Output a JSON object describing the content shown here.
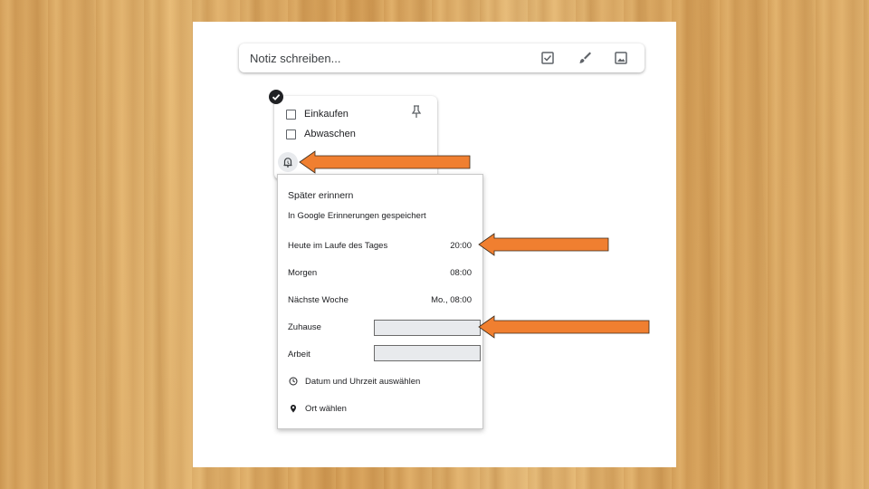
{
  "note_bar": {
    "placeholder": "Notiz schreiben...",
    "icons": [
      "checkbox-icon",
      "brush-icon",
      "image-icon"
    ]
  },
  "note_card": {
    "items": [
      {
        "label": "Einkaufen",
        "checked": false
      },
      {
        "label": "Abwaschen",
        "checked": false
      }
    ],
    "icons": [
      "pin-icon",
      "reminder-bell-icon",
      "selected-check-icon"
    ]
  },
  "reminder_menu": {
    "title": "Später erinnern",
    "subtitle": "In Google Erinnerungen gespeichert",
    "options": [
      {
        "label": "Heute im Laufe des Tages",
        "time": "20:00"
      },
      {
        "label": "Morgen",
        "time": "08:00"
      },
      {
        "label": "Nächste Woche",
        "time": "Mo., 08:00"
      }
    ],
    "locations": [
      {
        "label": "Zuhause",
        "value": ""
      },
      {
        "label": "Arbeit",
        "value": ""
      }
    ],
    "pick_datetime": "Datum und Uhrzeit auswählen",
    "pick_place": "Ort wählen"
  },
  "colors": {
    "arrow": "#f07f30",
    "arrow_outline": "#3a2a1a",
    "field_bg": "#e8eaed",
    "wood": "#dcaa62"
  }
}
